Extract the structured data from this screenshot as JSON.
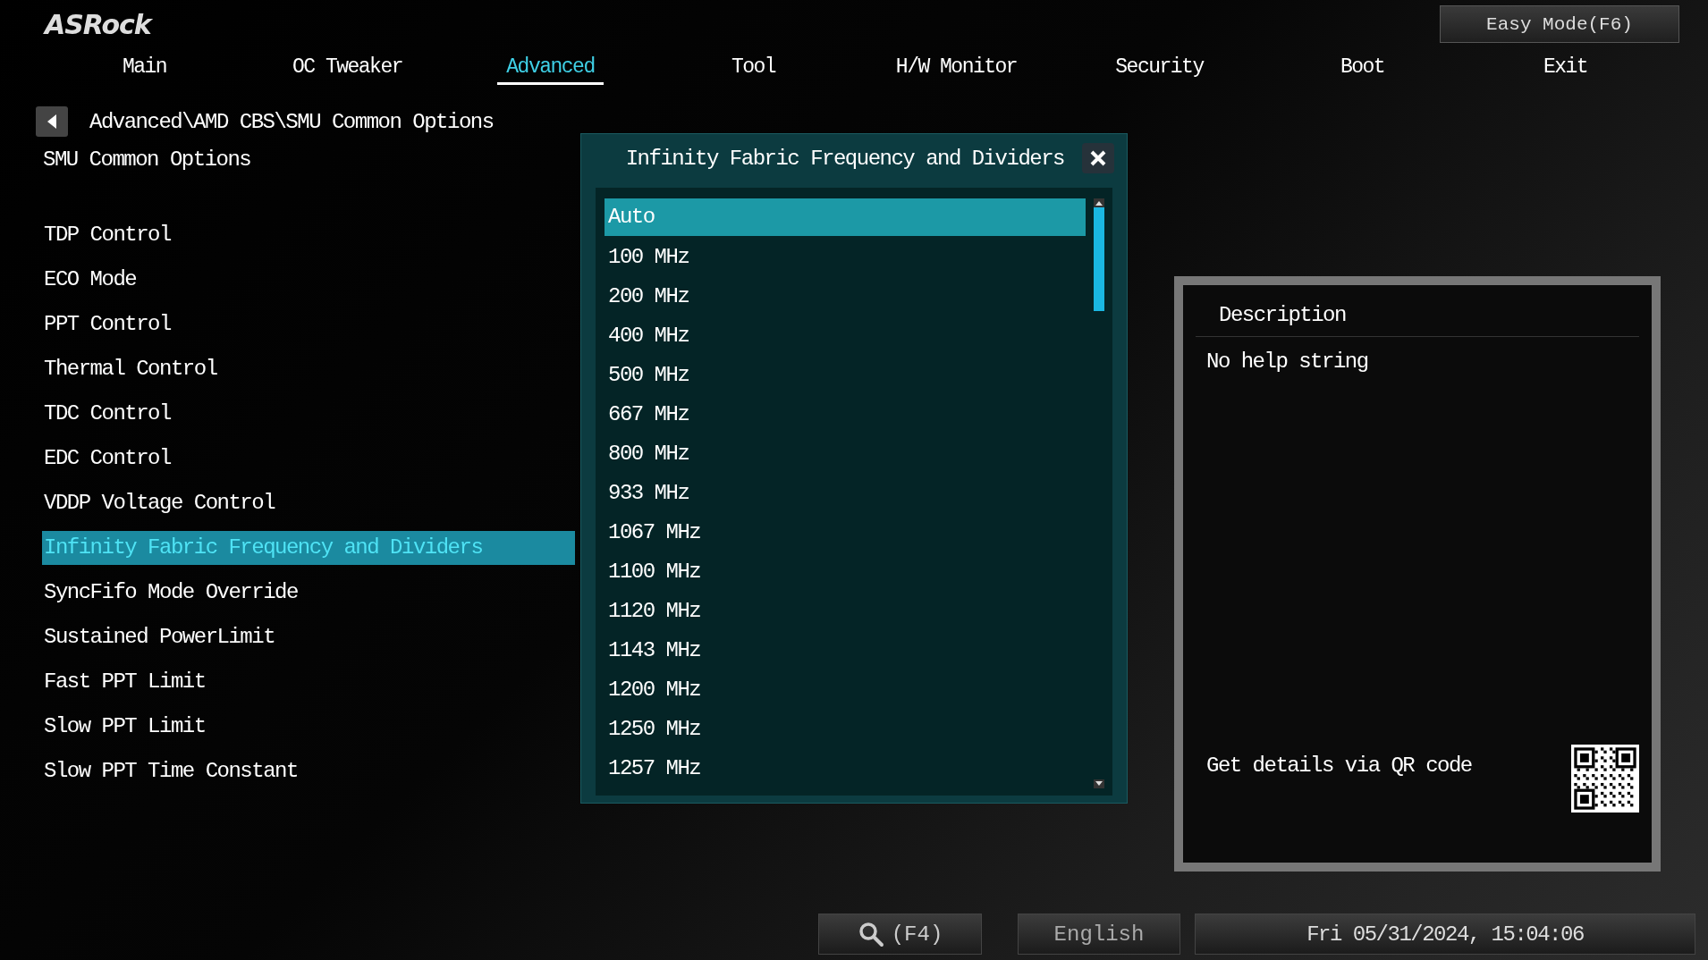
{
  "logo": "ASRock",
  "easy_mode_button": "Easy Mode(F6)",
  "tabs": [
    {
      "label": "Main",
      "selected": false
    },
    {
      "label": "OC Tweaker",
      "selected": false
    },
    {
      "label": "Advanced",
      "selected": true
    },
    {
      "label": "Tool",
      "selected": false
    },
    {
      "label": "H/W Monitor",
      "selected": false
    },
    {
      "label": "Security",
      "selected": false
    },
    {
      "label": "Boot",
      "selected": false
    },
    {
      "label": "Exit",
      "selected": false
    }
  ],
  "breadcrumb": "Advanced\\AMD CBS\\SMU Common Options",
  "section_title": "SMU Common Options",
  "menu_items": [
    {
      "label": "TDP Control",
      "selected": false
    },
    {
      "label": "ECO Mode",
      "selected": false
    },
    {
      "label": "PPT Control",
      "selected": false
    },
    {
      "label": "Thermal Control",
      "selected": false
    },
    {
      "label": "TDC Control",
      "selected": false
    },
    {
      "label": "EDC Control",
      "selected": false
    },
    {
      "label": "VDDP Voltage Control",
      "selected": false
    },
    {
      "label": "Infinity Fabric Frequency and Dividers",
      "selected": true
    },
    {
      "label": "SyncFifo Mode Override",
      "selected": false
    },
    {
      "label": "Sustained PowerLimit",
      "selected": false
    },
    {
      "label": "Fast PPT Limit",
      "selected": false
    },
    {
      "label": "Slow PPT Limit",
      "selected": false
    },
    {
      "label": "Slow PPT Time Constant",
      "selected": false
    }
  ],
  "dialog": {
    "title": "Infinity Fabric Frequency and Dividers",
    "options": [
      {
        "label": "Auto",
        "selected": true
      },
      {
        "label": "100 MHz",
        "selected": false
      },
      {
        "label": "200 MHz",
        "selected": false
      },
      {
        "label": "400 MHz",
        "selected": false
      },
      {
        "label": "500 MHz",
        "selected": false
      },
      {
        "label": "667 MHz",
        "selected": false
      },
      {
        "label": "800 MHz",
        "selected": false
      },
      {
        "label": "933 MHz",
        "selected": false
      },
      {
        "label": "1067 MHz",
        "selected": false
      },
      {
        "label": "1100 MHz",
        "selected": false
      },
      {
        "label": "1120 MHz",
        "selected": false
      },
      {
        "label": "1143 MHz",
        "selected": false
      },
      {
        "label": "1200 MHz",
        "selected": false
      },
      {
        "label": "1250 MHz",
        "selected": false
      },
      {
        "label": "1257 MHz",
        "selected": false
      }
    ]
  },
  "description": {
    "title": "Description",
    "text": "No help string",
    "qr_label": "Get details via QR code"
  },
  "status_bar": {
    "search_button": "(F4)",
    "language_button": "English",
    "datetime": "Fri 05/31/2024, 15:04:06"
  }
}
